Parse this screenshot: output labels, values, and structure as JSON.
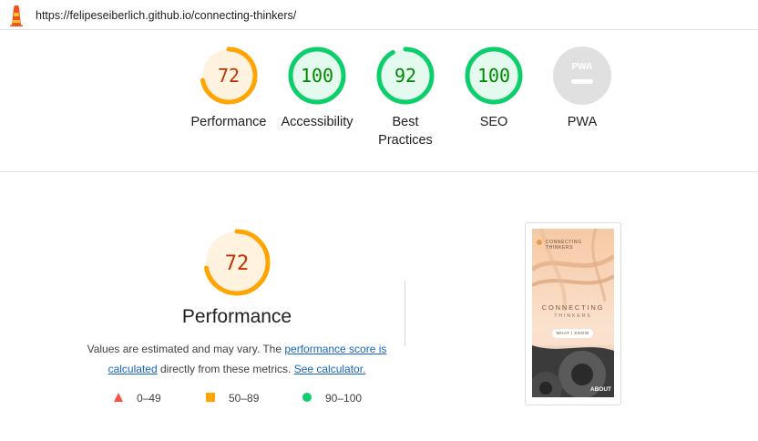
{
  "topbar": {
    "logo_icon": "lighthouse-icon",
    "url": "https://felipeseiberlich.github.io/connecting-thinkers/"
  },
  "colors": {
    "average": "#ffa400",
    "average_text": "#c33300",
    "average_bg": "#fff3e0",
    "pass": "#0cce6b",
    "pass_text": "#008800",
    "pass_bg": "#e5faef",
    "fail": "#ff4e42",
    "na": "#e0e0e0",
    "link": "#1565c0"
  },
  "gauges": [
    {
      "label": "Performance",
      "score": "72",
      "value": 72,
      "status": "average"
    },
    {
      "label": "Accessibility",
      "score": "100",
      "value": 100,
      "status": "pass"
    },
    {
      "label": "Best Practices",
      "score": "92",
      "value": 92,
      "status": "pass"
    },
    {
      "label": "SEO",
      "score": "100",
      "value": 100,
      "status": "pass"
    },
    {
      "label": "PWA",
      "score": "",
      "value": null,
      "status": "na",
      "badge": "PWA"
    }
  ],
  "performance": {
    "score": "72",
    "value": 72,
    "title": "Performance",
    "desc_prefix": "Values are estimated and may vary. The ",
    "link_score": "performance score is calculated",
    "desc_mid": " directly from these metrics. ",
    "link_calc": "See calculator.",
    "legend": [
      {
        "range": "0–49",
        "shape": "triangle-icon",
        "color": "#ff4e42"
      },
      {
        "range": "50–89",
        "shape": "square-icon",
        "color": "#ffa400"
      },
      {
        "range": "90–100",
        "shape": "circle-icon",
        "color": "#0cce6b"
      }
    ]
  },
  "screenshot": {
    "brand_line1": "CONNECTING",
    "brand_line2": "THINKERS",
    "title": "CONNECTING",
    "subtitle": "THINKERS",
    "button": "WHAT I KNOW",
    "about": "ABOUT"
  }
}
